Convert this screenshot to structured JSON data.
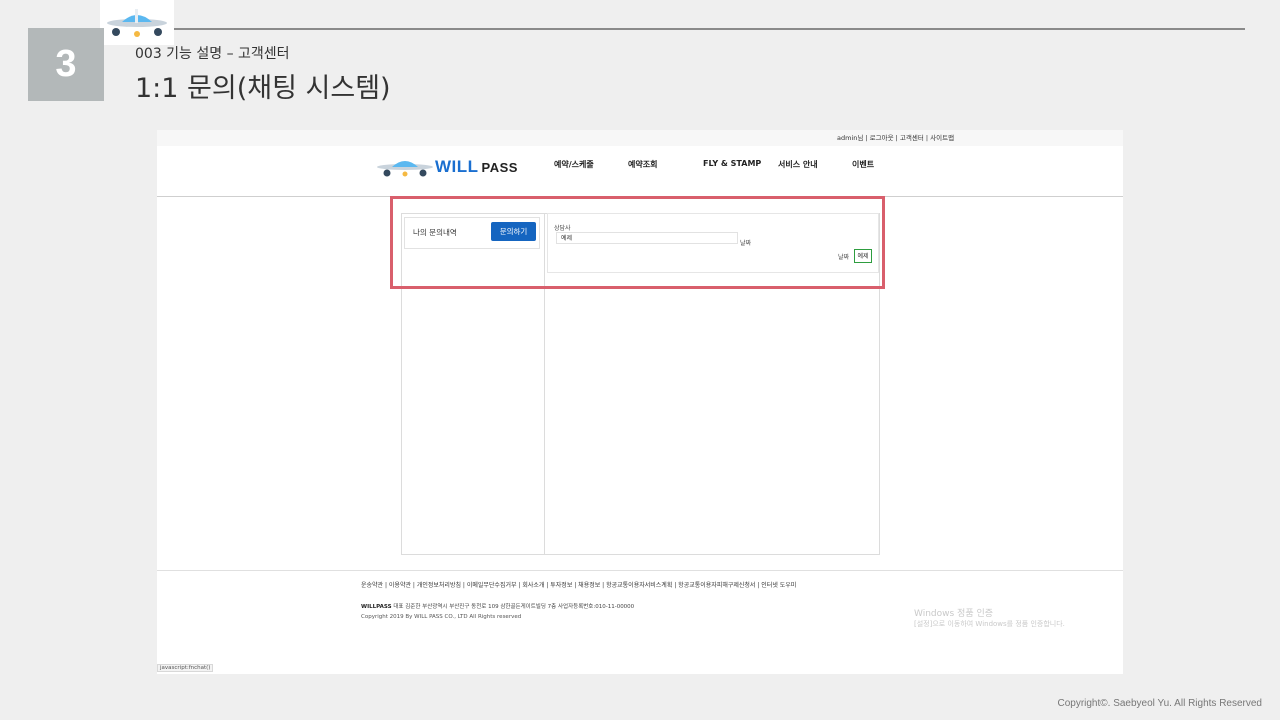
{
  "slide": {
    "number": "3",
    "subtitle": "003 기능 설명 – 고객센터",
    "title": "1:1 문의(채팅 시스템)",
    "copyright": "Copyright©. Saebyeol Yu. All Rights Reserved"
  },
  "site": {
    "util_links": "admin님 | 로그아웃 | 고객센터 | 사이트맵",
    "brand": {
      "will": "WILL",
      "pass": "PASS"
    },
    "nav": [
      "예약/스케줄",
      "예약조회",
      "FLY & STAMP",
      "서비스 안내",
      "이벤트"
    ]
  },
  "chat": {
    "my_inquiry_label": "나의 문의내역",
    "inquire_button": "문의하기",
    "agent_label": "상담사",
    "incoming_message": "예제",
    "incoming_date": "날짜",
    "outgoing_date": "날짜",
    "outgoing_message": "예제"
  },
  "footer": {
    "links": "운송약관 | 이용약관 | 개인정보처리방침 | 이메일무단수집거부 | 회사소개 | 투자정보 | 채용정보 | 항공교통이용자서비스계획 | 항공교통이용자피해구제신청서 | 인터넷 도우미",
    "company": "WILLPASS",
    "info": "대표 김준한 부산광역시 부산진구 동천로 109 삼한골든게이트빌딩 7층 사업자등록번호:010-11-00000",
    "copyright": "Copyright 2019 By WILL PASS CO., LTD All Rights reserved",
    "status_bar": "javascript:fnchat()"
  },
  "watermark": {
    "line1": "Windows 정품 인증",
    "line2": "[설정]으로 이동하여 Windows를 정품 인증합니다."
  },
  "colors": {
    "accent_blue": "#1565c0",
    "highlight_red": "#d95f6c",
    "outgoing_border_green": "#2e9d3f",
    "slide_number_gray": "#b3b8b9"
  }
}
